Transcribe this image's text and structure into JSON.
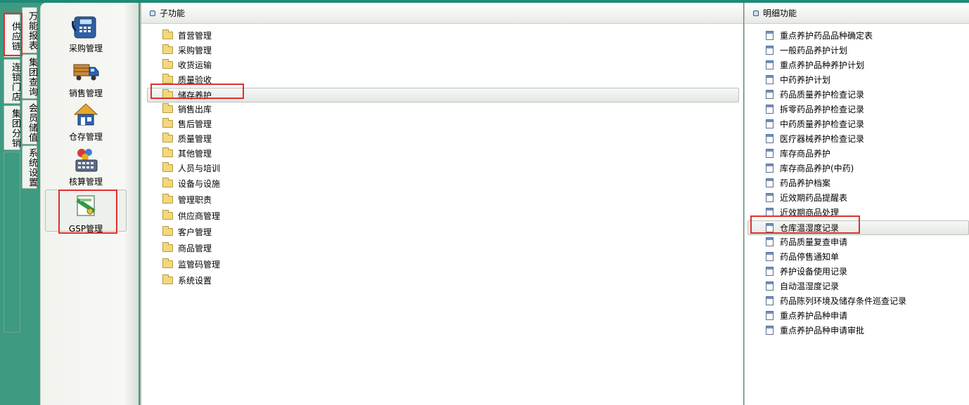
{
  "left_tabs": {
    "supply_chain": "供应链",
    "universal_reports": "万能报表",
    "chain_stores": "连锁门店",
    "group_query": "集团查询",
    "group_distribution": "集团分销",
    "member_stored_value": "会员储值",
    "system_settings": "系统设置"
  },
  "modules": [
    {
      "label": "采购管理",
      "icon": "purchase-terminal-icon"
    },
    {
      "label": "销售管理",
      "icon": "delivery-truck-icon"
    },
    {
      "label": "仓存管理",
      "icon": "warehouse-house-icon"
    },
    {
      "label": "核算管理",
      "icon": "calculator-icon"
    },
    {
      "label": "GSP管理",
      "icon": "gsp-certificate-icon"
    }
  ],
  "sub_panel": {
    "title": "子功能",
    "items": [
      "首营管理",
      "采购管理",
      "收货运输",
      "质量验收",
      "储存养护",
      "销售出库",
      "售后管理",
      "质量管理",
      "其他管理",
      "人员与培训",
      "设备与设施",
      "管理职责",
      "供应商管理",
      "客户管理",
      "商品管理",
      "监管码管理",
      "系统设置"
    ],
    "selected": "储存养护"
  },
  "detail_panel": {
    "title": "明细功能",
    "items": [
      "重点养护药品品种确定表",
      "一般药品养护计划",
      "重点养护品种养护计划",
      "中药养护计划",
      "药品质量养护检查记录",
      "拆零药品养护检查记录",
      "中药质量养护检查记录",
      "医疗器械养护检查记录",
      "库存商品养护",
      "库存商品养护(中药)",
      "药品养护档案",
      "近效期药品提醒表",
      "近效期商品处理",
      "仓库温湿度记录",
      "药品质量复查申请",
      "药品停售通知单",
      "养护设备使用记录",
      "自动温湿度记录",
      "药品陈列环境及储存条件巡查记录",
      "重点养护品种申请",
      "重点养护品种申请审批"
    ],
    "selected": "仓库温湿度记录"
  },
  "colors": {
    "background": "#3f9a82",
    "highlight_box": "#e0302e"
  }
}
